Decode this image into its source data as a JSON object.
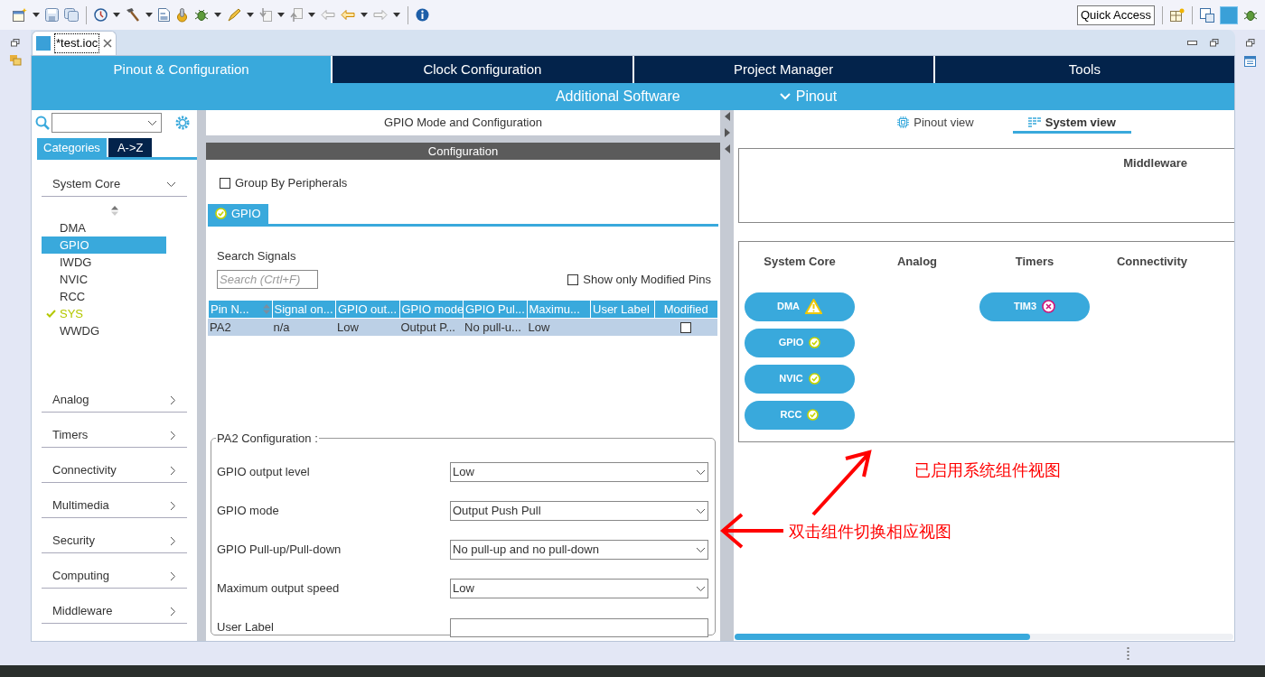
{
  "quick_access": {
    "label": "Quick Access"
  },
  "editor_tab": {
    "title": "*test.ioc"
  },
  "main_tabs": [
    {
      "label": "Pinout & Configuration",
      "selected": true
    },
    {
      "label": "Clock Configuration",
      "selected": false
    },
    {
      "label": "Project Manager",
      "selected": false
    },
    {
      "label": "Tools",
      "selected": false
    }
  ],
  "sub_menu": [
    {
      "label": "Additional Software",
      "kind": "plain"
    },
    {
      "label": "Pinout",
      "kind": "dropdown"
    }
  ],
  "sidebar": {
    "tabs": [
      {
        "label": "Categories",
        "selected": true
      },
      {
        "label": "A->Z",
        "selected": false
      }
    ],
    "categories": [
      {
        "label": "System Core",
        "expanded": true,
        "items": [
          {
            "label": "DMA",
            "selected": false,
            "configured": false
          },
          {
            "label": "GPIO",
            "selected": true,
            "configured": false
          },
          {
            "label": "IWDG",
            "selected": false,
            "configured": false
          },
          {
            "label": "NVIC",
            "selected": false,
            "configured": false
          },
          {
            "label": "RCC",
            "selected": false,
            "configured": false
          },
          {
            "label": "SYS",
            "selected": false,
            "configured": true
          },
          {
            "label": "WWDG",
            "selected": false,
            "configured": false
          }
        ]
      },
      {
        "label": "Analog",
        "expanded": false
      },
      {
        "label": "Timers",
        "expanded": false
      },
      {
        "label": "Connectivity",
        "expanded": false
      },
      {
        "label": "Multimedia",
        "expanded": false
      },
      {
        "label": "Security",
        "expanded": false
      },
      {
        "label": "Computing",
        "expanded": false
      },
      {
        "label": "Middleware",
        "expanded": false
      }
    ]
  },
  "mode_panel": {
    "title": "GPIO Mode and Configuration",
    "section": "Configuration",
    "group_by": {
      "label": "Group By Peripherals",
      "checked": false
    },
    "tab": {
      "label": "GPIO",
      "kind": "ok"
    },
    "search_label": "Search Signals",
    "search": {
      "placeholder": "Search (Crtl+F)"
    },
    "show_modified": {
      "label": "Show only Modified Pins",
      "checked": false
    },
    "table": {
      "columns": [
        "Pin N...",
        "Signal on...",
        "GPIO out...",
        "GPIO mode",
        "GPIO Pul...",
        "Maximu...",
        "User Label",
        "Modified"
      ],
      "rows": [
        {
          "cells": [
            "PA2",
            "n/a",
            "Low",
            "Output P...",
            "No pull-u...",
            "Low",
            ""
          ],
          "modified": false,
          "selected": true
        }
      ]
    },
    "config_title": "PA2 Configuration :",
    "fields": [
      {
        "label": "GPIO output level",
        "kind": "select",
        "value": "Low"
      },
      {
        "label": "GPIO mode",
        "kind": "select",
        "value": "Output Push Pull"
      },
      {
        "label": "GPIO Pull-up/Pull-down",
        "kind": "select",
        "value": "No pull-up and no pull-down"
      },
      {
        "label": "Maximum output speed",
        "kind": "select",
        "value": "Low"
      },
      {
        "label": "User Label",
        "kind": "text"
      }
    ]
  },
  "system_view": {
    "view_tabs": [
      {
        "label": "Pinout view",
        "selected": false,
        "kind": "chip"
      },
      {
        "label": "System view",
        "selected": true,
        "kind": "list"
      }
    ],
    "middleware_title": "Middleware",
    "groups": [
      {
        "title": "System Core",
        "components": [
          {
            "label": "DMA",
            "kind": "warning"
          },
          {
            "label": "GPIO",
            "kind": "ok"
          },
          {
            "label": "NVIC",
            "kind": "ok"
          },
          {
            "label": "RCC",
            "kind": "ok"
          }
        ]
      },
      {
        "title": "Analog"
      },
      {
        "title": "Timers",
        "components": [
          {
            "label": "TIM3",
            "kind": "error"
          }
        ]
      },
      {
        "title": "Connectivity"
      }
    ]
  },
  "annotations": [
    {
      "text": "已启用系统组件视图"
    },
    {
      "text": "双击组件切换相应视图"
    }
  ]
}
